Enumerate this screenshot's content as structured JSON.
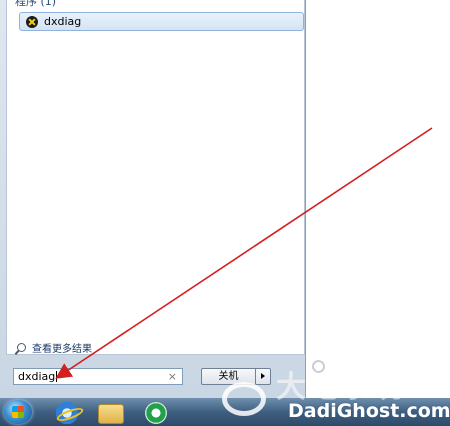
{
  "start_menu": {
    "section_header": "程序 (1)",
    "results": [
      {
        "label": "dxdiag",
        "icon": "directx-icon"
      }
    ],
    "see_more": "查看更多结果",
    "search": {
      "value": "dxdiag",
      "clear_glyph": "×"
    },
    "shutdown": {
      "label": "关机",
      "arrow_icon": "triangle-right-icon"
    }
  },
  "taskbar": {
    "items": [
      "start-orb",
      "internet-explorer-icon",
      "folder-icon",
      "ie-green-icon"
    ]
  },
  "watermark": {
    "cn": "大地系统",
    "en": "DadiGhost.com"
  },
  "annotation": {
    "color": "#d22020"
  }
}
